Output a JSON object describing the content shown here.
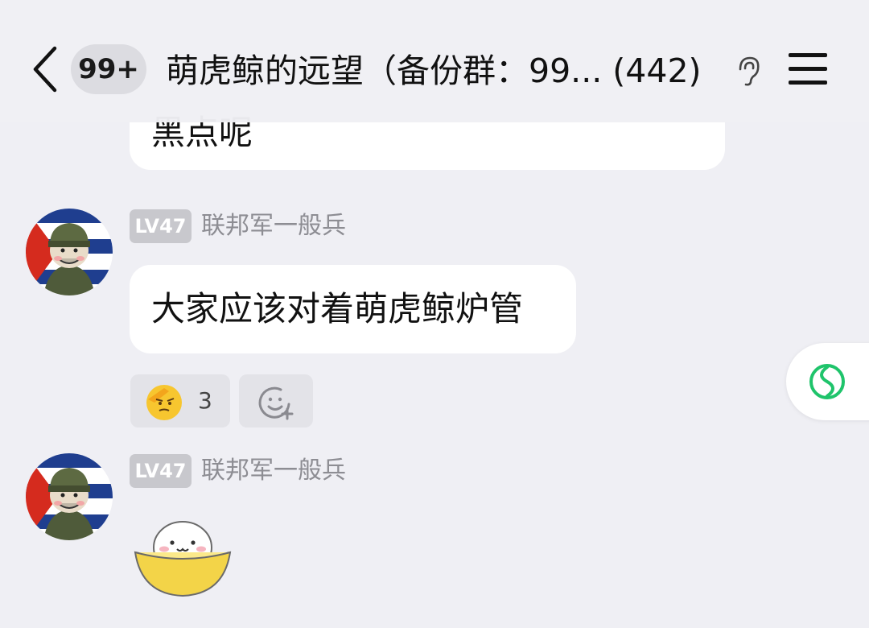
{
  "header": {
    "unread_badge": "99+",
    "title": "萌虎鲸的远望（备份群：99... (442)"
  },
  "messages": {
    "previous_text": "黑点呢",
    "first": {
      "level": "LV47",
      "sender": "联邦军一般兵",
      "text": "大家应该对着萌虎鲸炉管",
      "reaction_count": "3"
    },
    "second": {
      "level": "LV47",
      "sender": "联邦军一般兵"
    }
  },
  "icons": {
    "back": "chevron-left-icon",
    "ear": "ear-icon",
    "menu": "hamburger-menu-icon",
    "salute_emoji": "salute-emoji-icon",
    "add_reaction": "add-reaction-icon",
    "float": "green-swirl-icon"
  },
  "colors": {
    "background": "#efeff4",
    "bubble": "#ffffff",
    "level_badge": "#c8c8cd",
    "accent_green": "#1fc46b"
  }
}
